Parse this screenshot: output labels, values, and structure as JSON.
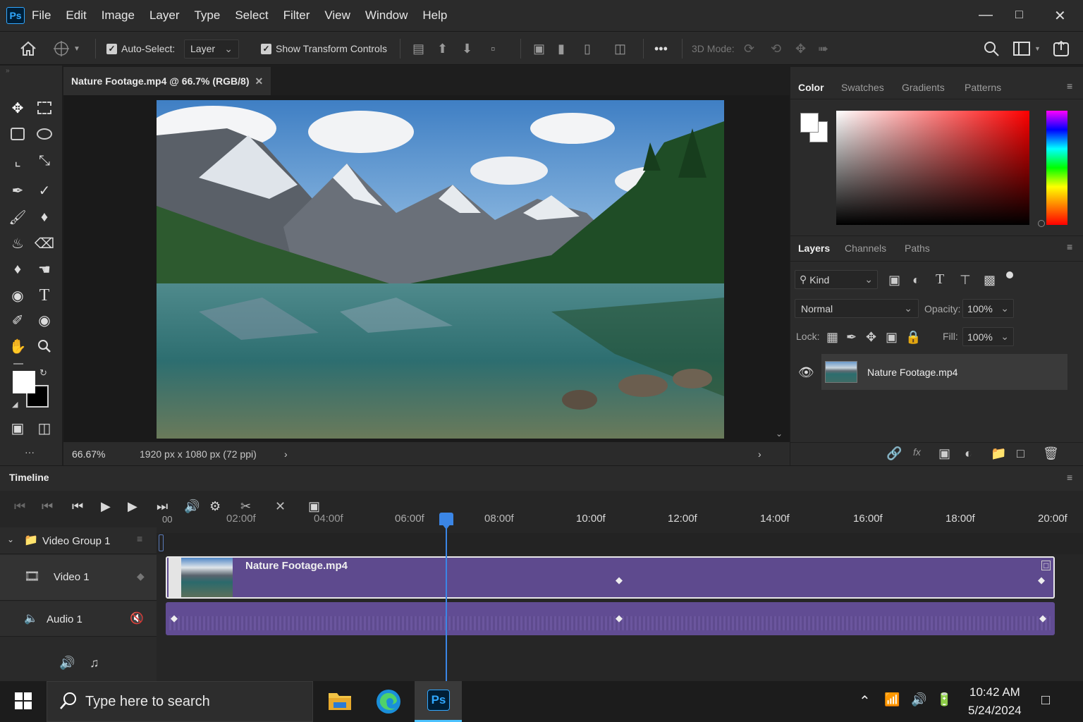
{
  "app": {
    "logo": "Ps",
    "menus": [
      "File",
      "Edit",
      "Image",
      "Layer",
      "Type",
      "Select",
      "Filter",
      "View",
      "Window",
      "Help"
    ]
  },
  "window_controls": {
    "minimize_icon": "minimize-icon",
    "maximize_icon": "maximize-icon",
    "close_icon": "close-icon"
  },
  "options": {
    "auto_select_label": "Auto-Select:",
    "auto_select_value": "Layer",
    "show_transform_label": "Show Transform Controls",
    "mode_3d_label": "3D Mode:",
    "more": "•••"
  },
  "document": {
    "tab_title": "Nature Footage.mp4 @ 66.7% (RGB/8)",
    "zoom": "66.67%",
    "dimensions": "1920 px x 1080 px (72 ppi)"
  },
  "color_panel": {
    "tabs": [
      "Color",
      "Swatches",
      "Gradients",
      "Patterns"
    ],
    "hue": "#ff0000"
  },
  "layers_panel": {
    "tabs": [
      "Layers",
      "Channels",
      "Paths"
    ],
    "filter_label": "Kind",
    "blend_mode": "Normal",
    "opacity_label": "Opacity:",
    "opacity_value": "100%",
    "lock_label": "Lock:",
    "fill_label": "Fill:",
    "fill_value": "100%",
    "layer_name": "Nature Footage.mp4"
  },
  "timeline": {
    "title": "Timeline",
    "ruler": [
      "00",
      "02:00f",
      "04:00f",
      "06:00f",
      "08:00f",
      "10:00f",
      "12:00f",
      "14:00f",
      "16:00f",
      "18:00f",
      "20:00f"
    ],
    "playhead": "06:00f",
    "group_label": "Video Group 1",
    "video_track_label": "Video 1",
    "audio_track_label": "Audio 1",
    "clip_name": "Nature Footage.mp4",
    "clip_color": "#5e4a8e"
  },
  "taskbar": {
    "search_placeholder": "Type here to search",
    "time": "10:42 AM",
    "date": "5/24/2024",
    "ps_label": "Ps"
  }
}
